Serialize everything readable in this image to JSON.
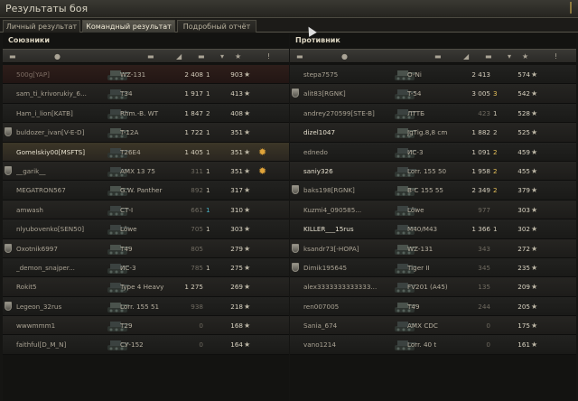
{
  "window": {
    "title": "Результаты боя"
  },
  "tabs": [
    {
      "label": "Личный результат"
    },
    {
      "label": "Командный результат"
    },
    {
      "label": "Подробный отчёт"
    }
  ],
  "teams": {
    "allies": {
      "title": "Союзники",
      "rows": [
        {
          "name": "500g[YAP]",
          "tank": "WZ-131",
          "damage": "2 408",
          "kills": "1",
          "xp": "903",
          "badge": false,
          "highlight": false
        },
        {
          "name": "sam_ti_krivorukiy_6...",
          "tank": "T34",
          "damage": "1 917",
          "kills": "1",
          "xp": "413",
          "badge": false
        },
        {
          "name": "Ham_i_lion[KATB]",
          "tank": "Rhm.-B. WT",
          "damage": "1 847",
          "kills": "2",
          "xp": "408",
          "badge": false
        },
        {
          "name": "buldozer_ivan[V-E-D]",
          "tank": "T-12A",
          "damage": "1 722",
          "kills": "1",
          "xp": "351",
          "badge": true
        },
        {
          "name": "Gomelskiy00[MSFTS]",
          "tank": "T26E4",
          "damage": "1 405",
          "kills": "1",
          "xp": "351",
          "badge": false,
          "highlight": true,
          "medal": true
        },
        {
          "name": "__garik__",
          "tank": "AMX 13 75",
          "damage": "311",
          "kills": "1",
          "xp": "351",
          "badge": true,
          "medal": true
        },
        {
          "name": "MEGATRON567",
          "tank": "G.W. Panther",
          "damage": "892",
          "kills": "1",
          "xp": "317",
          "badge": false
        },
        {
          "name": "amwash",
          "tank": "СТ-I",
          "damage": "661",
          "kills": "1",
          "xp": "310",
          "badge": false
        },
        {
          "name": "nlyubovenko[SEN50]",
          "tank": "Löwe",
          "damage": "705",
          "kills": "1",
          "xp": "303",
          "badge": false
        },
        {
          "name": "Oxotnik6997",
          "tank": "T49",
          "damage": "805",
          "kills": "",
          "xp": "279",
          "badge": true
        },
        {
          "name": "_demon_snajper...",
          "tank": "ИС-3",
          "damage": "785",
          "kills": "1",
          "xp": "275",
          "badge": false
        },
        {
          "name": "Rokit5",
          "tank": "Type 4 Heavy",
          "damage": "1 275",
          "kills": "",
          "xp": "269",
          "badge": false
        },
        {
          "name": "Legeon_32rus",
          "tank": "Lorr. 155 51",
          "damage": "938",
          "kills": "",
          "xp": "218",
          "badge": true
        },
        {
          "name": "wwwmmm1",
          "tank": "T29",
          "damage": "0",
          "kills": "",
          "xp": "168",
          "badge": false
        },
        {
          "name": "faithful[D_M_N]",
          "tank": "СУ-152",
          "damage": "0",
          "kills": "",
          "xp": "164",
          "badge": false
        }
      ]
    },
    "enemies": {
      "title": "Противник",
      "rows": [
        {
          "name": "stepa7575",
          "tank": "O-Ni",
          "damage": "2 413",
          "kills": "",
          "xp": "574",
          "badge": false
        },
        {
          "name": "alit83[RGNK]",
          "tank": "T-54",
          "damage": "3 005",
          "kills": "3",
          "xp": "542",
          "badge": true
        },
        {
          "name": "andrey270599[STE-B]",
          "tank": "ЛТТБ",
          "damage": "423",
          "kills": "1",
          "xp": "528",
          "badge": false
        },
        {
          "name": "dizel1047",
          "tank": "JgTig.8,8 cm",
          "damage": "1 882",
          "kills": "2",
          "xp": "525",
          "badge": false
        },
        {
          "name": "ednedo",
          "tank": "ИС-3",
          "damage": "1 091",
          "kills": "2",
          "xp": "459",
          "badge": false
        },
        {
          "name": "saniy326",
          "tank": "Lorr. 155 50",
          "damage": "1 958",
          "kills": "2",
          "xp": "455",
          "badge": false
        },
        {
          "name": "baks198[RGNK]",
          "tank": "B-C 155 55",
          "damage": "2 349",
          "kills": "2",
          "xp": "379",
          "badge": true
        },
        {
          "name": "Kuzmi4_090585...",
          "tank": "Löwe",
          "damage": "977",
          "kills": "",
          "xp": "303",
          "badge": false
        },
        {
          "name": "KILLER___15rus",
          "tank": "M40/M43",
          "damage": "1 366",
          "kills": "1",
          "xp": "302",
          "badge": false
        },
        {
          "name": "ksandr73[-HOPA]",
          "tank": "WZ-131",
          "damage": "343",
          "kills": "",
          "xp": "272",
          "badge": true
        },
        {
          "name": "Dimik195645",
          "tank": "Tiger II",
          "damage": "345",
          "kills": "",
          "xp": "235",
          "badge": true
        },
        {
          "name": "alex3333333333333...",
          "tank": "FV201 (A45)",
          "damage": "135",
          "kills": "",
          "xp": "209",
          "badge": false
        },
        {
          "name": "ren007005",
          "tank": "T49",
          "damage": "244",
          "kills": "",
          "xp": "205",
          "badge": false
        },
        {
          "name": "Sania_674",
          "tank": "AMX CDC",
          "damage": "0",
          "kills": "",
          "xp": "175",
          "badge": false
        },
        {
          "name": "vano1214",
          "tank": "Lorr. 40 t",
          "damage": "0",
          "kills": "",
          "xp": "161",
          "badge": false
        }
      ]
    }
  },
  "icons": {
    "star": "★",
    "medal": "✹",
    "sort": "▾"
  }
}
